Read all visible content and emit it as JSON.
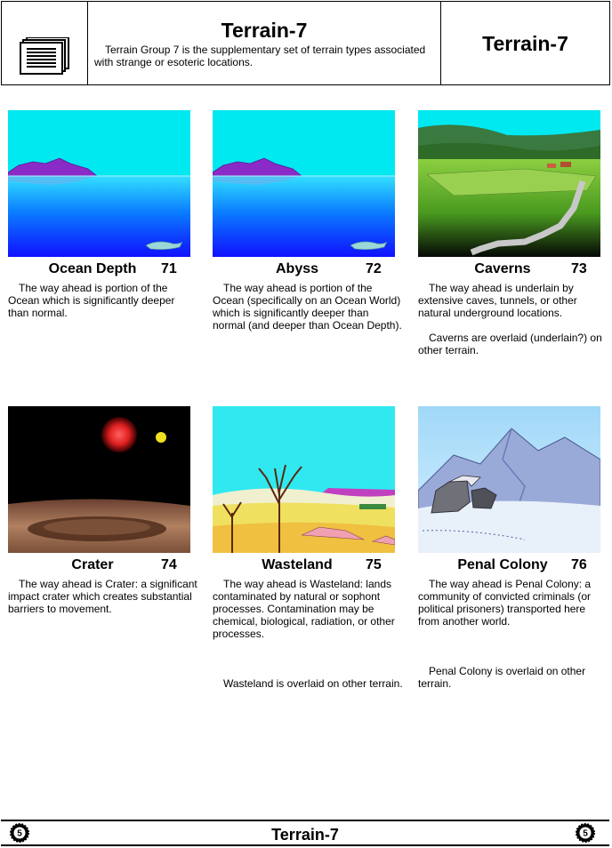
{
  "header": {
    "title": "Terrain-7",
    "description": "Terrain Group 7 is the supplementary set of terrain types associated with strange or esoteric locations.",
    "right_title": "Terrain-7"
  },
  "cards": [
    {
      "name": "Ocean Depth",
      "number": "71",
      "paragraphs": [
        "The way ahead is portion of the Ocean which is significantly deeper than normal."
      ]
    },
    {
      "name": "Abyss",
      "number": "72",
      "paragraphs": [
        "The way ahead is portion of the Ocean (specifically on an Ocean World) which is significantly deeper than normal (and deeper than Ocean Depth)."
      ]
    },
    {
      "name": "Caverns",
      "number": "73",
      "paragraphs": [
        "The way ahead is underlain by extensive caves, tunnels, or other natural underground locations.",
        "Caverns are overlaid (underlain?) on other terrain."
      ]
    },
    {
      "name": "Crater",
      "number": "74",
      "paragraphs": [
        "The way ahead is Crater: a significant impact crater which creates substantial barriers to movement."
      ]
    },
    {
      "name": "Wasteland",
      "number": "75",
      "paragraphs": [
        "The way ahead is Wasteland: lands contaminated by natural or sophont processes. Contamination may be chemical, biological, radiation, or other processes.",
        "Wasteland is overlaid on other terrain."
      ]
    },
    {
      "name": "Penal Colony",
      "number": "76",
      "paragraphs": [
        "The way ahead is Penal Colony: a community of convicted criminals (or political prisoners) transported here from another world.",
        "Penal Colony is overlaid on other terrain."
      ]
    }
  ],
  "footer": {
    "title": "Terrain-7",
    "badge_left": "5",
    "badge_right": "5"
  }
}
